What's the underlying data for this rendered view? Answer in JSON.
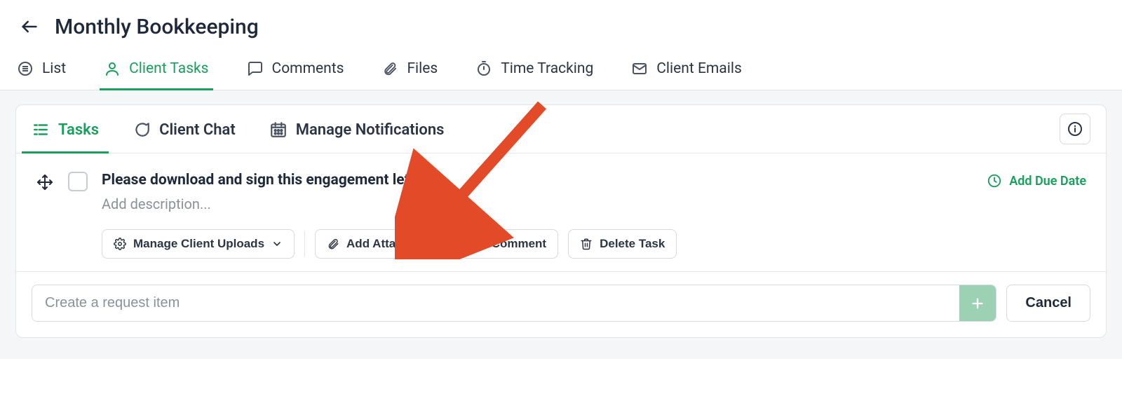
{
  "header": {
    "title": "Monthly Bookkeeping"
  },
  "topTabs": {
    "list": "List",
    "clientTasks": "Client Tasks",
    "comments": "Comments",
    "files": "Files",
    "timeTracking": "Time Tracking",
    "clientEmails": "Client Emails"
  },
  "subTabs": {
    "tasks": "Tasks",
    "clientChat": "Client Chat",
    "manageNotifications": "Manage Notifications"
  },
  "task": {
    "title": "Please download and sign this engagement letter",
    "descriptionPlaceholder": "Add description...",
    "dueDate": "Add Due Date"
  },
  "actions": {
    "manageUploads": "Manage Client Uploads",
    "addAttachment": "Add Attachment",
    "comment": "Comment",
    "deleteTask": "Delete Task"
  },
  "createRow": {
    "placeholder": "Create a request item",
    "cancel": "Cancel"
  }
}
